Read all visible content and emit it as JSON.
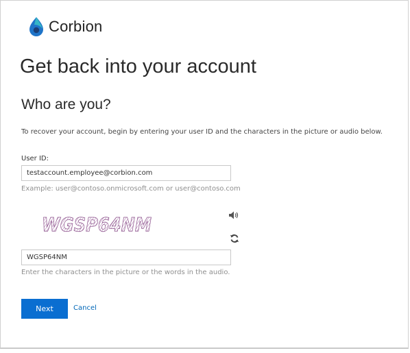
{
  "brand": {
    "name": "Corbion",
    "logo_icon": "corbion-drop-icon",
    "colors": {
      "mark_blue": "#1f74c8",
      "mark_teal": "#35b6c6",
      "mark_dark": "#1b3f76"
    }
  },
  "page": {
    "title": "Get back into your account",
    "section_title": "Who are you?",
    "instructions": "To recover your account, begin by entering your user ID and the characters in the picture or audio below."
  },
  "form": {
    "userid_label": "User ID:",
    "userid_value": "testaccount.employee@corbion.com",
    "userid_hint": "Example: user@contoso.onmicrosoft.com or user@contoso.com",
    "captcha_text": "WGSP64NM",
    "captcha_input_value": "WGSP64NM",
    "captcha_hint": "Enter the characters in the picture or the words in the audio.",
    "audio_icon": "speaker-icon",
    "refresh_icon": "refresh-icon"
  },
  "actions": {
    "next_label": "Next",
    "cancel_label": "Cancel",
    "primary_color": "#0a6ed1",
    "link_color": "#0067b8"
  }
}
